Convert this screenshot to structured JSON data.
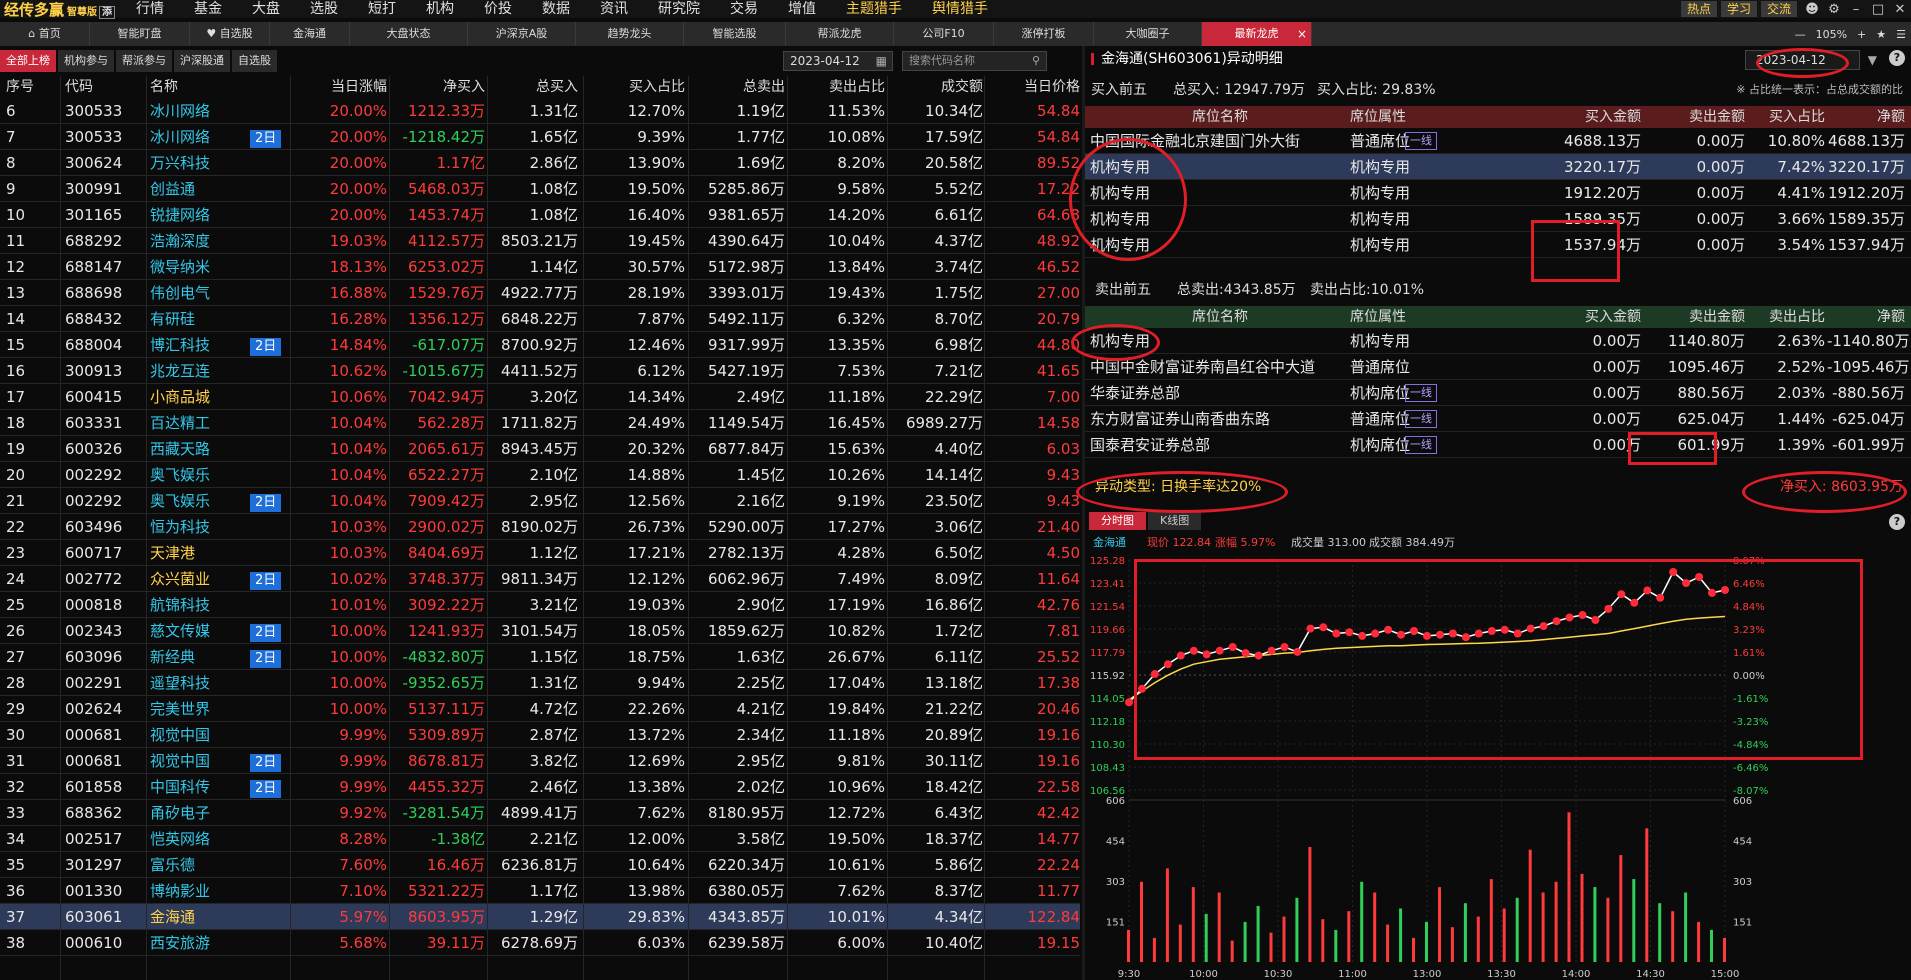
{
  "app": {
    "name": "经传多赢",
    "edition": "智尊版",
    "badge": "添"
  },
  "topnav": [
    "行情",
    "基金",
    "大盘",
    "选股",
    "短打",
    "机构",
    "价投",
    "数据",
    "资讯",
    "研究院",
    "交易",
    "增值",
    "主题猎手",
    "舆情猎手"
  ],
  "topright": {
    "buttons": [
      "热点",
      "学习",
      "交流"
    ]
  },
  "tabs": [
    "首页",
    "智能盯盘",
    "自选股",
    "金海通",
    "大盘状态",
    "沪深京A股",
    "趋势龙头",
    "智能选股",
    "帮派龙虎",
    "公司F10",
    "涨停打板",
    "大咖圈子",
    "最新龙虎"
  ],
  "tabright": {
    "zoom": "105%"
  },
  "subtabs": [
    "全部上榜",
    "机构参与",
    "帮派参与",
    "沪深股通",
    "自选股"
  ],
  "date_filter": "2023-04-12",
  "search_placeholder": "搜索代码名称",
  "colors": {
    "up": "#ff3b3b",
    "down": "#2fd05a",
    "accent": "#c8283a",
    "avg_line": "#ffd84a",
    "price_line": "#ffffff",
    "highlight": "#ffd14a",
    "badge": "#1e6fd9"
  },
  "table": {
    "headers": [
      "序号",
      "代码",
      "名称",
      "",
      "当日涨幅",
      "净买入",
      "总买入",
      "买入占比",
      "总卖出",
      "卖出占比",
      "成交额",
      "当日价格"
    ],
    "rows": [
      {
        "no": "6",
        "code": "300533",
        "name": "冰川网络",
        "tag": "",
        "chg": "20.00%",
        "net": "1212.33万",
        "buy": "1.31亿",
        "buyp": "12.70%",
        "sell": "1.19亿",
        "sellp": "11.53%",
        "amt": "10.34亿",
        "price": "54.84"
      },
      {
        "no": "7",
        "code": "300533",
        "name": "冰川网络",
        "tag": "2日",
        "chg": "20.00%",
        "net": "-1218.42万",
        "buy": "1.65亿",
        "buyp": "9.39%",
        "sell": "1.77亿",
        "sellp": "10.08%",
        "amt": "17.59亿",
        "price": "54.84"
      },
      {
        "no": "8",
        "code": "300624",
        "name": "万兴科技",
        "tag": "",
        "chg": "20.00%",
        "net": "1.17亿",
        "buy": "2.86亿",
        "buyp": "13.90%",
        "sell": "1.69亿",
        "sellp": "8.20%",
        "amt": "20.58亿",
        "price": "89.52"
      },
      {
        "no": "9",
        "code": "300991",
        "name": "创益通",
        "tag": "",
        "chg": "20.00%",
        "net": "5468.03万",
        "buy": "1.08亿",
        "buyp": "19.50%",
        "sell": "5285.86万",
        "sellp": "9.58%",
        "amt": "5.52亿",
        "price": "17.22"
      },
      {
        "no": "10",
        "code": "301165",
        "name": "锐捷网络",
        "tag": "",
        "chg": "20.00%",
        "net": "1453.74万",
        "buy": "1.08亿",
        "buyp": "16.40%",
        "sell": "9381.65万",
        "sellp": "14.20%",
        "amt": "6.61亿",
        "price": "64.68"
      },
      {
        "no": "11",
        "code": "688292",
        "name": "浩瀚深度",
        "tag": "",
        "chg": "19.03%",
        "net": "4112.57万",
        "buy": "8503.21万",
        "buyp": "19.45%",
        "sell": "4390.64万",
        "sellp": "10.04%",
        "amt": "4.37亿",
        "price": "48.92"
      },
      {
        "no": "12",
        "code": "688147",
        "name": "微导纳米",
        "tag": "",
        "chg": "18.13%",
        "net": "6253.02万",
        "buy": "1.14亿",
        "buyp": "30.57%",
        "sell": "5172.98万",
        "sellp": "13.84%",
        "amt": "3.74亿",
        "price": "46.52"
      },
      {
        "no": "13",
        "code": "688698",
        "name": "伟创电气",
        "tag": "",
        "chg": "16.88%",
        "net": "1529.76万",
        "buy": "4922.77万",
        "buyp": "28.19%",
        "sell": "3393.01万",
        "sellp": "19.43%",
        "amt": "1.75亿",
        "price": "27.00"
      },
      {
        "no": "14",
        "code": "688432",
        "name": "有研硅",
        "tag": "",
        "chg": "16.28%",
        "net": "1356.12万",
        "buy": "6848.22万",
        "buyp": "7.87%",
        "sell": "5492.11万",
        "sellp": "6.32%",
        "amt": "8.70亿",
        "price": "20.79"
      },
      {
        "no": "15",
        "code": "688004",
        "name": "博汇科技",
        "tag": "2日",
        "chg": "14.84%",
        "net": "-617.07万",
        "buy": "8700.92万",
        "buyp": "12.46%",
        "sell": "9317.99万",
        "sellp": "13.35%",
        "amt": "6.98亿",
        "price": "44.80"
      },
      {
        "no": "16",
        "code": "300913",
        "name": "兆龙互连",
        "tag": "",
        "chg": "10.62%",
        "net": "-1015.67万",
        "buy": "4411.52万",
        "buyp": "6.12%",
        "sell": "5427.19万",
        "sellp": "7.53%",
        "amt": "7.21亿",
        "price": "41.65"
      },
      {
        "no": "17",
        "code": "600415",
        "name": "小商品城",
        "tag": "",
        "chg": "10.06%",
        "net": "7042.94万",
        "buy": "3.20亿",
        "buyp": "14.34%",
        "sell": "2.49亿",
        "sellp": "11.18%",
        "amt": "22.29亿",
        "price": "7.00"
      },
      {
        "no": "18",
        "code": "603331",
        "name": "百达精工",
        "tag": "",
        "chg": "10.04%",
        "net": "562.28万",
        "buy": "1711.82万",
        "buyp": "24.49%",
        "sell": "1149.54万",
        "sellp": "16.45%",
        "amt": "6989.27万",
        "price": "14.58"
      },
      {
        "no": "19",
        "code": "600326",
        "name": "西藏天路",
        "tag": "",
        "chg": "10.04%",
        "net": "2065.61万",
        "buy": "8943.45万",
        "buyp": "20.32%",
        "sell": "6877.84万",
        "sellp": "15.63%",
        "amt": "4.40亿",
        "price": "6.03"
      },
      {
        "no": "20",
        "code": "002292",
        "name": "奥飞娱乐",
        "tag": "",
        "chg": "10.04%",
        "net": "6522.27万",
        "buy": "2.10亿",
        "buyp": "14.88%",
        "sell": "1.45亿",
        "sellp": "10.26%",
        "amt": "14.14亿",
        "price": "9.43"
      },
      {
        "no": "21",
        "code": "002292",
        "name": "奥飞娱乐",
        "tag": "2日",
        "chg": "10.04%",
        "net": "7909.42万",
        "buy": "2.95亿",
        "buyp": "12.56%",
        "sell": "2.16亿",
        "sellp": "9.19%",
        "amt": "23.50亿",
        "price": "9.43"
      },
      {
        "no": "22",
        "code": "603496",
        "name": "恒为科技",
        "tag": "",
        "chg": "10.03%",
        "net": "2900.02万",
        "buy": "8190.02万",
        "buyp": "26.73%",
        "sell": "5290.00万",
        "sellp": "17.27%",
        "amt": "3.06亿",
        "price": "21.40"
      },
      {
        "no": "23",
        "code": "600717",
        "name": "天津港",
        "tag": "",
        "chg": "10.03%",
        "net": "8404.69万",
        "buy": "1.12亿",
        "buyp": "17.21%",
        "sell": "2782.13万",
        "sellp": "4.28%",
        "amt": "6.50亿",
        "price": "4.50"
      },
      {
        "no": "24",
        "code": "002772",
        "name": "众兴菌业",
        "tag": "2日",
        "chg": "10.02%",
        "net": "3748.37万",
        "buy": "9811.34万",
        "buyp": "12.12%",
        "sell": "6062.96万",
        "sellp": "7.49%",
        "amt": "8.09亿",
        "price": "11.64"
      },
      {
        "no": "25",
        "code": "000818",
        "name": "航锦科技",
        "tag": "",
        "chg": "10.01%",
        "net": "3092.22万",
        "buy": "3.21亿",
        "buyp": "19.03%",
        "sell": "2.90亿",
        "sellp": "17.19%",
        "amt": "16.86亿",
        "price": "42.76"
      },
      {
        "no": "26",
        "code": "002343",
        "name": "慈文传媒",
        "tag": "2日",
        "chg": "10.00%",
        "net": "1241.93万",
        "buy": "3101.54万",
        "buyp": "18.05%",
        "sell": "1859.62万",
        "sellp": "10.82%",
        "amt": "1.72亿",
        "price": "7.81"
      },
      {
        "no": "27",
        "code": "603096",
        "name": "新经典",
        "tag": "2日",
        "chg": "10.00%",
        "net": "-4832.80万",
        "buy": "1.15亿",
        "buyp": "18.75%",
        "sell": "1.63亿",
        "sellp": "26.67%",
        "amt": "6.11亿",
        "price": "25.52"
      },
      {
        "no": "28",
        "code": "002291",
        "name": "遥望科技",
        "tag": "",
        "chg": "10.00%",
        "net": "-9352.65万",
        "buy": "1.31亿",
        "buyp": "9.94%",
        "sell": "2.25亿",
        "sellp": "17.04%",
        "amt": "13.18亿",
        "price": "17.38"
      },
      {
        "no": "29",
        "code": "002624",
        "name": "完美世界",
        "tag": "",
        "chg": "10.00%",
        "net": "5137.11万",
        "buy": "4.72亿",
        "buyp": "22.26%",
        "sell": "4.21亿",
        "sellp": "19.84%",
        "amt": "21.22亿",
        "price": "20.46"
      },
      {
        "no": "30",
        "code": "000681",
        "name": "视觉中国",
        "tag": "",
        "chg": "9.99%",
        "net": "5309.89万",
        "buy": "2.87亿",
        "buyp": "13.72%",
        "sell": "2.34亿",
        "sellp": "11.18%",
        "amt": "20.89亿",
        "price": "19.16"
      },
      {
        "no": "31",
        "code": "000681",
        "name": "视觉中国",
        "tag": "2日",
        "chg": "9.99%",
        "net": "8678.81万",
        "buy": "3.82亿",
        "buyp": "12.69%",
        "sell": "2.95亿",
        "sellp": "9.81%",
        "amt": "30.11亿",
        "price": "19.16"
      },
      {
        "no": "32",
        "code": "601858",
        "name": "中国科传",
        "tag": "2日",
        "chg": "9.99%",
        "net": "4455.32万",
        "buy": "2.46亿",
        "buyp": "13.38%",
        "sell": "2.02亿",
        "sellp": "10.96%",
        "amt": "18.42亿",
        "price": "22.58"
      },
      {
        "no": "33",
        "code": "688362",
        "name": "甬矽电子",
        "tag": "",
        "chg": "9.92%",
        "net": "-3281.54万",
        "buy": "4899.41万",
        "buyp": "7.62%",
        "sell": "8180.95万",
        "sellp": "12.72%",
        "amt": "6.43亿",
        "price": "42.42"
      },
      {
        "no": "34",
        "code": "002517",
        "name": "恺英网络",
        "tag": "",
        "chg": "8.28%",
        "net": "-1.38亿",
        "buy": "2.21亿",
        "buyp": "12.00%",
        "sell": "3.58亿",
        "sellp": "19.50%",
        "amt": "18.37亿",
        "price": "14.77"
      },
      {
        "no": "35",
        "code": "301297",
        "name": "富乐德",
        "tag": "",
        "chg": "7.60%",
        "net": "16.46万",
        "buy": "6236.81万",
        "buyp": "10.64%",
        "sell": "6220.34万",
        "sellp": "10.61%",
        "amt": "5.86亿",
        "price": "22.24"
      },
      {
        "no": "36",
        "code": "001330",
        "name": "博纳影业",
        "tag": "",
        "chg": "7.10%",
        "net": "5321.22万",
        "buy": "1.17亿",
        "buyp": "13.98%",
        "sell": "6380.05万",
        "sellp": "7.62%",
        "amt": "8.37亿",
        "price": "11.77"
      },
      {
        "no": "37",
        "code": "603061",
        "name": "金海通",
        "tag": "",
        "chg": "5.97%",
        "net": "8603.95万",
        "buy": "1.29亿",
        "buyp": "29.83%",
        "sell": "4343.85万",
        "sellp": "10.01%",
        "amt": "4.34亿",
        "price": "122.84",
        "selected": true
      },
      {
        "no": "38",
        "code": "000610",
        "name": "西安旅游",
        "tag": "",
        "chg": "5.68%",
        "net": "39.11万",
        "buy": "6278.69万",
        "buyp": "6.03%",
        "sell": "6239.58万",
        "sellp": "6.00%",
        "amt": "10.40亿",
        "price": "19.15"
      }
    ]
  },
  "detail": {
    "title": "金海通(SH603061)异动明细",
    "date": "2023-04-12",
    "buy_summary": {
      "label": "买入前五",
      "total": "总买入: 12947.79万",
      "ratio": "买入占比: 29.83%",
      "note": "※ 占比统一表示：占总成交额的比"
    },
    "headers": [
      "席位名称",
      "席位属性",
      "买入金额",
      "卖出金额",
      "买入占比",
      "净额"
    ],
    "sell_headers": [
      "席位名称",
      "席位属性",
      "买入金额",
      "卖出金额",
      "卖出占比",
      "净额"
    ],
    "line_tag": "一线",
    "buy_rows": [
      {
        "name": "中国国际金融北京建国门外大街",
        "line": true,
        "attr": "普通席位",
        "buy": "4688.13万",
        "sell": "0.00万",
        "ratio": "10.80%",
        "net": "4688.13万"
      },
      {
        "name": "机构专用",
        "line": false,
        "attr": "机构专用",
        "buy": "3220.17万",
        "sell": "0.00万",
        "ratio": "7.42%",
        "net": "3220.17万",
        "selected": true
      },
      {
        "name": "机构专用",
        "line": false,
        "attr": "机构专用",
        "buy": "1912.20万",
        "sell": "0.00万",
        "ratio": "4.41%",
        "net": "1912.20万"
      },
      {
        "name": "机构专用",
        "line": false,
        "attr": "机构专用",
        "buy": "1589.35万",
        "sell": "0.00万",
        "ratio": "3.66%",
        "net": "1589.35万"
      },
      {
        "name": "机构专用",
        "line": false,
        "attr": "机构专用",
        "buy": "1537.94万",
        "sell": "0.00万",
        "ratio": "3.54%",
        "net": "1537.94万"
      }
    ],
    "sell_summary": {
      "label": "卖出前五",
      "total": "总卖出:4343.85万",
      "ratio": "卖出占比:10.01%"
    },
    "sell_rows": [
      {
        "name": "机构专用",
        "line": false,
        "attr": "机构专用",
        "buy": "0.00万",
        "sell": "1140.80万",
        "ratio": "2.63%",
        "net": "-1140.80万"
      },
      {
        "name": "中国中金财富证券南昌红谷中大道",
        "line": false,
        "attr": "普通席位",
        "buy": "0.00万",
        "sell": "1095.46万",
        "ratio": "2.52%",
        "net": "-1095.46万"
      },
      {
        "name": "华泰证券总部",
        "line": true,
        "attr": "机构席位",
        "buy": "0.00万",
        "sell": "880.56万",
        "ratio": "2.03%",
        "net": "-880.56万"
      },
      {
        "name": "东方财富证券山南香曲东路",
        "line": true,
        "attr": "普通席位",
        "buy": "0.00万",
        "sell": "625.04万",
        "ratio": "1.44%",
        "net": "-625.04万"
      },
      {
        "name": "国泰君安证券总部",
        "line": true,
        "attr": "机构席位",
        "buy": "0.00万",
        "sell": "601.99万",
        "ratio": "1.39%",
        "net": "-601.99万"
      }
    ],
    "anomaly_type": "异动类型: 日换手率达20%",
    "net_buy": "净买入: 8603.95万",
    "chart_tabs": [
      "分时图",
      "K线图"
    ]
  },
  "chart_data": {
    "type": "line",
    "info": {
      "name": "金海通",
      "price_label": "现价",
      "price": "122.84",
      "chg_label": "涨幅",
      "chg": "5.97%",
      "vol_label": "成交量",
      "vol": "313.00",
      "amt_label": "成交额",
      "amt": "384.49万"
    },
    "y_left_ticks": [
      "125.28",
      "123.41",
      "121.54",
      "119.66",
      "117.79",
      "115.92",
      "114.05",
      "112.18",
      "110.30",
      "108.43",
      "106.56"
    ],
    "y_right_ticks": [
      "8.07%",
      "6.46%",
      "4.84%",
      "3.23%",
      "1.61%",
      "0.00%",
      "-1.61%",
      "-3.23%",
      "-4.84%",
      "-6.46%",
      "-8.07%"
    ],
    "x_ticks": [
      "9:30",
      "10:00",
      "10:30",
      "11:00",
      "13:00",
      "13:30",
      "14:00",
      "14:30",
      "15:00"
    ],
    "ylim": [
      106.56,
      125.28
    ],
    "prev_close": 115.92,
    "price": [
      113.7,
      114.8,
      116.0,
      116.8,
      117.5,
      117.9,
      117.6,
      117.9,
      118.2,
      117.7,
      117.5,
      117.9,
      118.2,
      117.8,
      119.7,
      119.8,
      119.3,
      119.4,
      119.1,
      119.3,
      119.6,
      119.2,
      119.5,
      119.1,
      119.2,
      119.3,
      119.0,
      119.3,
      119.5,
      119.6,
      119.3,
      119.7,
      119.9,
      120.3,
      120.6,
      120.8,
      120.4,
      121.3,
      122.5,
      121.8,
      122.8,
      122.2,
      124.3,
      123.4,
      123.9,
      122.6,
      122.84
    ],
    "avg": [
      113.9,
      114.6,
      115.3,
      115.9,
      116.4,
      116.8,
      117.0,
      117.2,
      117.3,
      117.4,
      117.5,
      117.6,
      117.7,
      117.75,
      117.9,
      118.0,
      118.1,
      118.15,
      118.2,
      118.25,
      118.3,
      118.3,
      118.35,
      118.4,
      118.42,
      118.45,
      118.48,
      118.5,
      118.55,
      118.6,
      118.65,
      118.7,
      118.8,
      118.9,
      119.0,
      119.1,
      119.2,
      119.3,
      119.5,
      119.7,
      119.9,
      120.1,
      120.3,
      120.45,
      120.55,
      120.62,
      120.68
    ],
    "vol_ticks": [
      "606",
      "454",
      "303",
      "151"
    ],
    "vol_max": 606,
    "volume": [
      120,
      300,
      90,
      350,
      140,
      280,
      180,
      260,
      80,
      150,
      210,
      110,
      170,
      240,
      430,
      160,
      120,
      190,
      300,
      260,
      140,
      200,
      90,
      150,
      280,
      130,
      220,
      170,
      310,
      200,
      240,
      420,
      260,
      300,
      560,
      330,
      280,
      240,
      400,
      310,
      500,
      220,
      190,
      260,
      150,
      120,
      90
    ]
  }
}
